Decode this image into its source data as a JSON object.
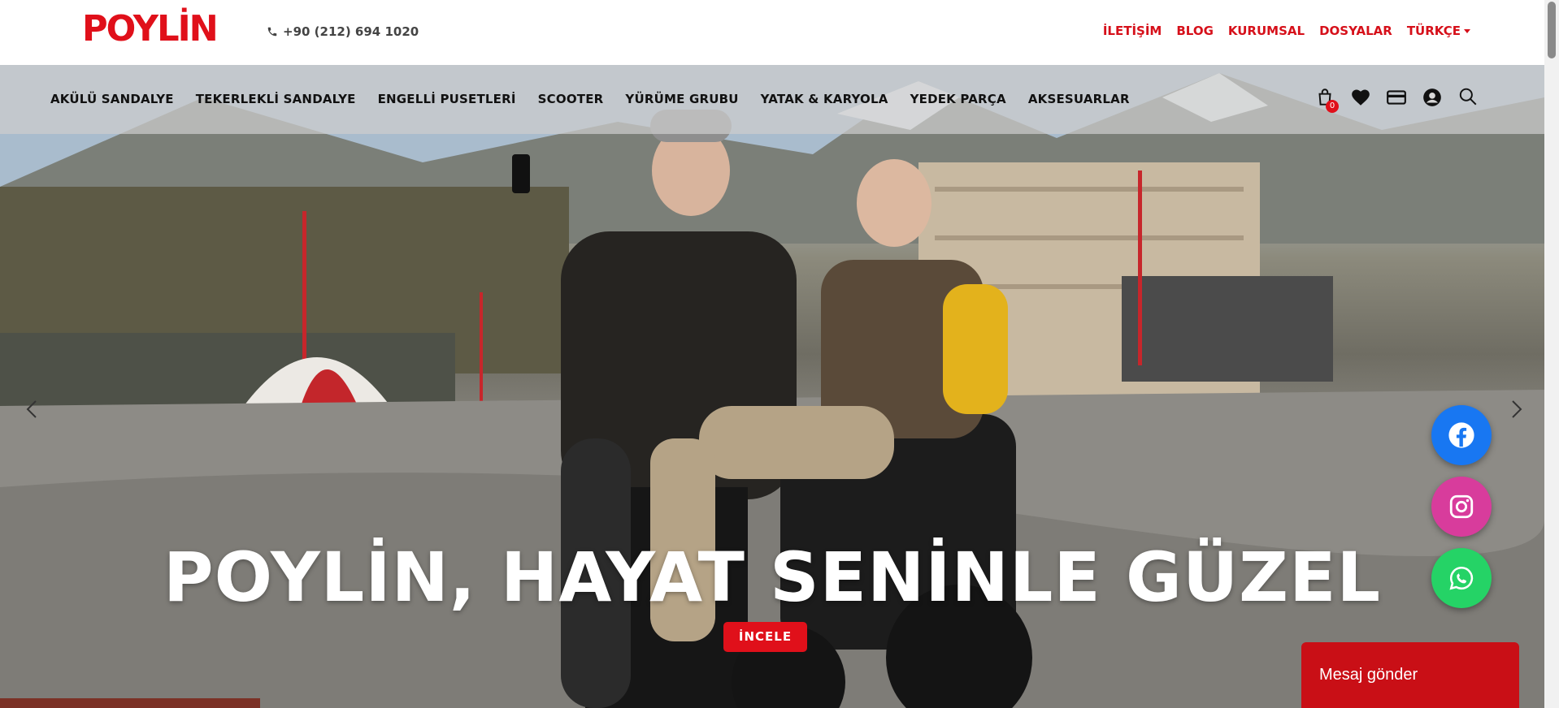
{
  "brand": {
    "logo_text": "POYLİN",
    "color": "#e0101a"
  },
  "header": {
    "phone": "+90 (212) 694 1020",
    "links": [
      "İLETİŞİM",
      "BLOG",
      "KURUMSAL",
      "DOSYALAR"
    ],
    "language": "TÜRKÇE"
  },
  "nav": {
    "items": [
      "AKÜLÜ SANDALYE",
      "TEKERLEKLİ SANDALYE",
      "ENGELLİ PUSETLERİ",
      "SCOOTER",
      "YÜRÜME GRUBU",
      "YATAK & KARYOLA",
      "YEDEK PARÇA",
      "AKSESUARLAR"
    ],
    "icons": [
      "cart-icon",
      "heart-icon",
      "credit-card-icon",
      "user-icon",
      "search-icon"
    ],
    "cart_count": "0"
  },
  "hero": {
    "headline": "POYLİN, HAYAT SENİNLE GÜZEL",
    "button": "İNCELE"
  },
  "social": [
    {
      "name": "facebook",
      "color": "#1877f2"
    },
    {
      "name": "instagram",
      "color": "#d83c9c"
    },
    {
      "name": "whatsapp",
      "color": "#25d366"
    }
  ],
  "chat": {
    "label": "Mesaj gönder",
    "color": "#c90f16"
  }
}
